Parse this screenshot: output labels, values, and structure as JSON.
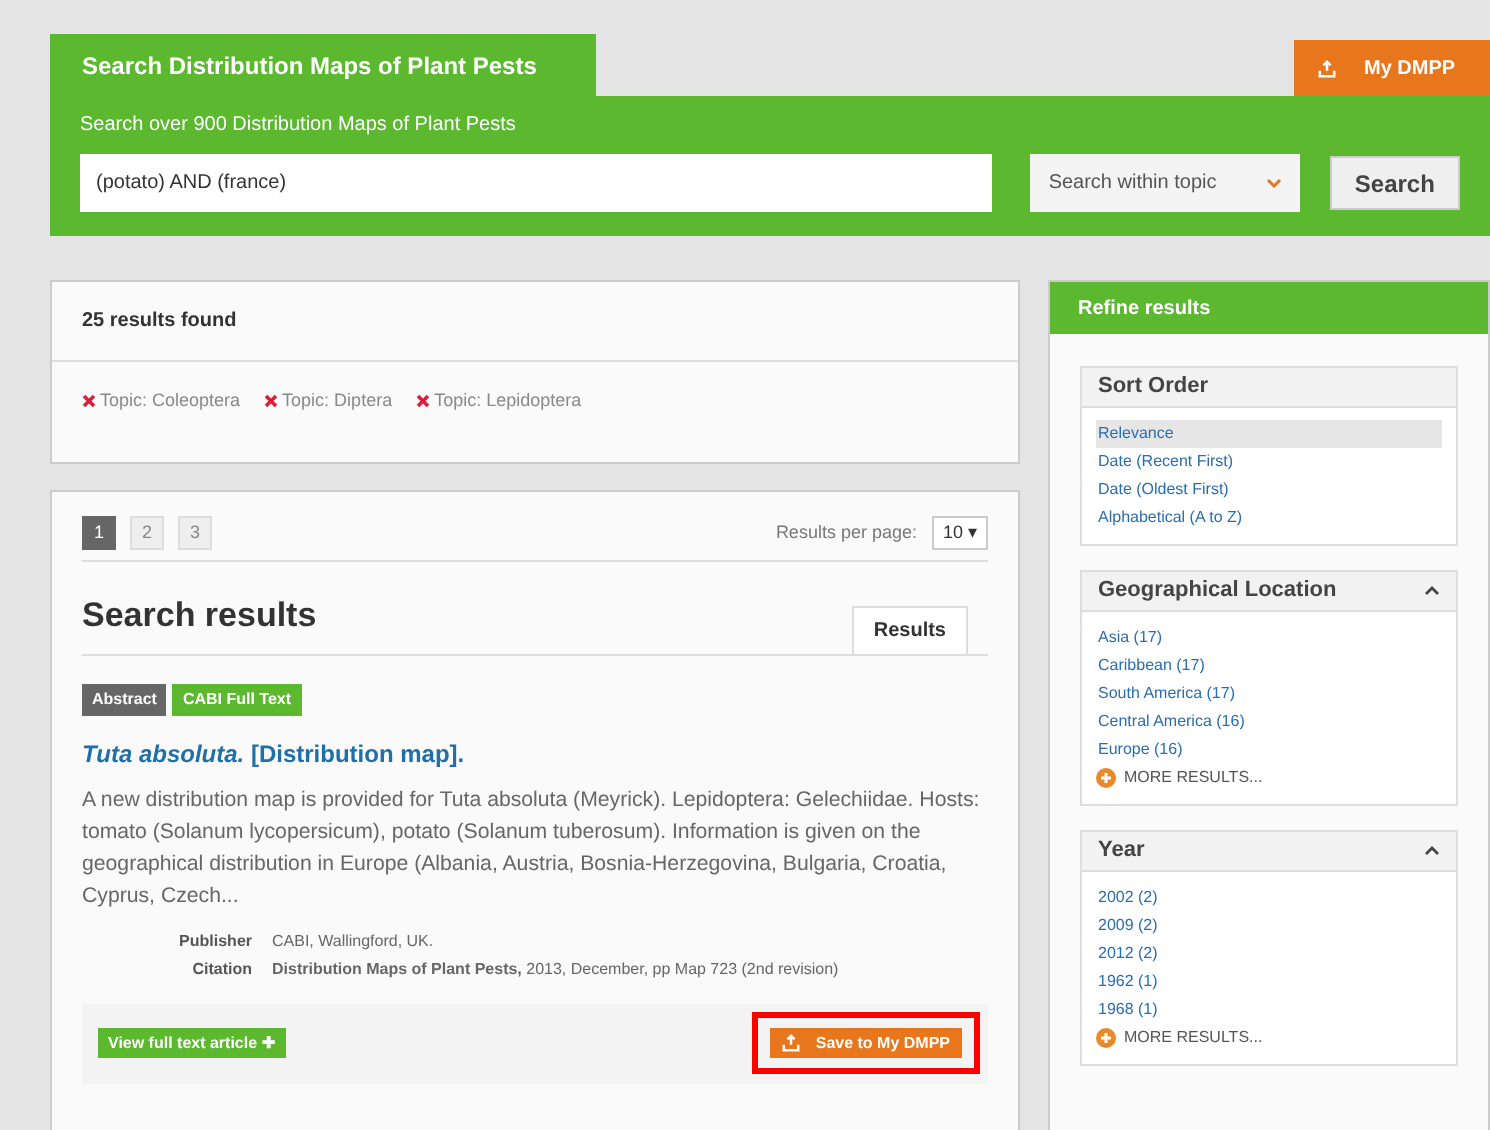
{
  "header": {
    "tab": "Search Distribution Maps of Plant Pests",
    "my_dmpp": "My DMPP",
    "subtitle": "Search over 900 Distribution Maps of Plant Pests",
    "query": "(potato) AND (france)",
    "topic_select": "Search within topic",
    "search_button": "Search"
  },
  "summary": {
    "count": "25 results found",
    "filters": [
      "Topic: Coleoptera",
      "Topic: Diptera",
      "Topic: Lepidoptera"
    ]
  },
  "pagination": {
    "pages": [
      {
        "label": "1",
        "selected": true
      },
      {
        "label": "2",
        "selected": false
      },
      {
        "label": "3",
        "selected": false
      }
    ],
    "per_page_label": "Results per page:",
    "per_page": "10 ▾"
  },
  "results_heading": "Search results",
  "results_tab": "Results",
  "result": {
    "badges": [
      {
        "label": "Abstract",
        "color": "#666666"
      },
      {
        "label": "CABI Full Text",
        "color": "#5cb82e"
      }
    ],
    "title": "*Tuta absoluta.* [Distribution map].",
    "abstract": "A new distribution map is provided for Tuta absoluta (Meyrick). Lepidoptera: Gelechiidae. Hosts: tomato (Solanum lycopersicum), potato (Solanum tuberosum). Information is given on the geographical distribution in Europe (Albania, Austria, Bosnia-Herzegovina, Bulgaria, Croatia, Cyprus, Czech...",
    "meta": [
      {
        "label": "Publisher",
        "value": "CABI, Wallingford, UK."
      },
      {
        "label": "Citation",
        "value": "**Distribution Maps of Plant Pests,** 2013, December, pp Map 723 (2nd revision)"
      }
    ],
    "view_button": "View full text article ✚",
    "save_button": "Save to My DMPP",
    "save_highlighted": true
  },
  "refine": {
    "title": "Refine results",
    "sections": [
      {
        "title": "Sort Order",
        "collapsible": false,
        "items": [
          {
            "label": "Relevance",
            "selected": true
          },
          {
            "label": "Date (Recent First)",
            "selected": false
          },
          {
            "label": "Date (Oldest First)",
            "selected": false
          },
          {
            "label": "Alphabetical (A to Z)",
            "selected": false
          }
        ]
      },
      {
        "title": "Geographical Location",
        "collapsible": true,
        "items": [
          {
            "label": "Asia (17)",
            "selected": false
          },
          {
            "label": "Caribbean (17)",
            "selected": false
          },
          {
            "label": "South America (17)",
            "selected": false
          },
          {
            "label": "Central America (16)",
            "selected": false
          },
          {
            "label": "Europe (16)",
            "selected": false
          }
        ],
        "more": "MORE RESULTS..."
      },
      {
        "title": "Year",
        "collapsible": true,
        "items": [
          {
            "label": "2002 (2)",
            "selected": false
          },
          {
            "label": "2009 (2)",
            "selected": false
          },
          {
            "label": "2012 (2)",
            "selected": false
          },
          {
            "label": "1962 (1)",
            "selected": false
          },
          {
            "label": "1968 (1)",
            "selected": false
          }
        ],
        "more": "MORE RESULTS..."
      }
    ]
  }
}
